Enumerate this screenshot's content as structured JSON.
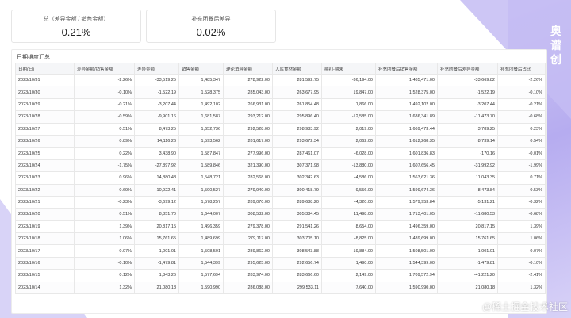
{
  "brand": "奥谱创",
  "watermark": "@稀土掘金技术社区",
  "summary": [
    {
      "title": "总（差异金额 / 销售金额）",
      "value": "0.21%"
    },
    {
      "title": "补充团餐后差异",
      "value": "0.02%"
    }
  ],
  "table_title": "日期维度汇总",
  "columns": [
    "日期(日)",
    "差异金额/销售金额",
    "差异金额",
    "销售金额",
    "理论消耗金额",
    "入库食材金额",
    "期初-期末",
    "补充团餐后销售金额",
    "补充团餐后差异金额",
    "补充团餐后占比"
  ],
  "rows": [
    [
      "2023/10/31",
      "-2.26%",
      "-33,519.25",
      "1,485,347",
      "278,922.00",
      "281,592.75",
      "-36,194.00",
      "1,485,471.00",
      "-33,669.82",
      "-2.26%"
    ],
    [
      "2023/10/30",
      "-0.10%",
      "-1,522.19",
      "1,528,375",
      "285,043.00",
      "263,677.95",
      "19,847.00",
      "1,528,375.00",
      "-1,522.19",
      "-0.10%"
    ],
    [
      "2023/10/29",
      "-0.21%",
      "-3,207.44",
      "1,492,102",
      "266,931.00",
      "261,854.48",
      "1,866.00",
      "1,492,102.00",
      "-3,207.44",
      "-0.21%"
    ],
    [
      "2023/10/28",
      "-0.59%",
      "-9,901.16",
      "1,681,587",
      "293,212.00",
      "295,896.40",
      "-12,585.00",
      "1,686,341.89",
      "-11,473.70",
      "-0.68%"
    ],
    [
      "2023/10/27",
      "0.51%",
      "8,473.25",
      "1,652,736",
      "292,528.00",
      "298,983.92",
      "2,019.00",
      "1,669,473.44",
      "3,789.25",
      "0.23%"
    ],
    [
      "2023/10/26",
      "0.89%",
      "14,116.26",
      "1,593,562",
      "281,617.00",
      "293,672.34",
      "2,062.00",
      "1,612,268.35",
      "8,739.14",
      "0.54%"
    ],
    [
      "2023/10/25",
      "0.22%",
      "3,438.90",
      "1,587,847",
      "277,996.00",
      "287,461.07",
      "-6,028.00",
      "1,601,836.83",
      "-170.16",
      "-0.01%"
    ],
    [
      "2023/10/24",
      "-1.75%",
      "-27,897.92",
      "1,589,846",
      "321,390.00",
      "307,371.98",
      "-13,880.00",
      "1,607,656.45",
      "-31,992.92",
      "-1.99%"
    ],
    [
      "2023/10/23",
      "0.96%",
      "14,880.48",
      "1,548,721",
      "282,568.00",
      "302,342.63",
      "-4,586.00",
      "1,563,621.36",
      "11,043.35",
      "0.71%"
    ],
    [
      "2023/10/22",
      "0.69%",
      "10,922.41",
      "1,590,527",
      "279,940.00",
      "300,418.79",
      "-9,556.00",
      "1,599,674.36",
      "8,473.84",
      "0.53%"
    ],
    [
      "2023/10/21",
      "-0.23%",
      "-3,699.12",
      "1,578,257",
      "289,070.00",
      "289,688.20",
      "-4,320.00",
      "1,579,953.84",
      "-5,131.21",
      "-0.32%"
    ],
    [
      "2023/10/20",
      "0.51%",
      "8,351.70",
      "1,644,007",
      "308,532.00",
      "305,384.45",
      "11,498.00",
      "1,713,401.05",
      "-11,680.53",
      "-0.68%"
    ],
    [
      "2023/10/19",
      "1.39%",
      "20,817.15",
      "1,496,359",
      "279,378.00",
      "291,541.26",
      "8,654.00",
      "1,496,359.00",
      "20,817.15",
      "1.39%"
    ],
    [
      "2023/10/18",
      "1.06%",
      "15,761.65",
      "1,489,699",
      "279,117.00",
      "303,705.10",
      "-8,825.00",
      "1,489,699.00",
      "15,761.65",
      "1.06%"
    ],
    [
      "2023/10/17",
      "-0.07%",
      "-1,001.01",
      "1,508,501",
      "289,862.00",
      "308,543.88",
      "-19,884.00",
      "1,508,501.00",
      "-1,001.01",
      "-0.07%"
    ],
    [
      "2023/10/16",
      "-0.10%",
      "-1,479.81",
      "1,544,399",
      "295,625.00",
      "292,656.74",
      "1,490.00",
      "1,544,399.00",
      "-1,479.81",
      "-0.10%"
    ],
    [
      "2023/10/15",
      "0.12%",
      "1,843.26",
      "1,577,694",
      "283,974.00",
      "283,666.60",
      "2,149.00",
      "1,709,572.94",
      "-41,221.20",
      "-2.41%"
    ],
    [
      "2023/10/14",
      "1.32%",
      "21,080.18",
      "1,590,990",
      "286,088.00",
      "299,533.11",
      "7,640.00",
      "1,590,990.00",
      "21,080.18",
      "1.32%"
    ]
  ]
}
